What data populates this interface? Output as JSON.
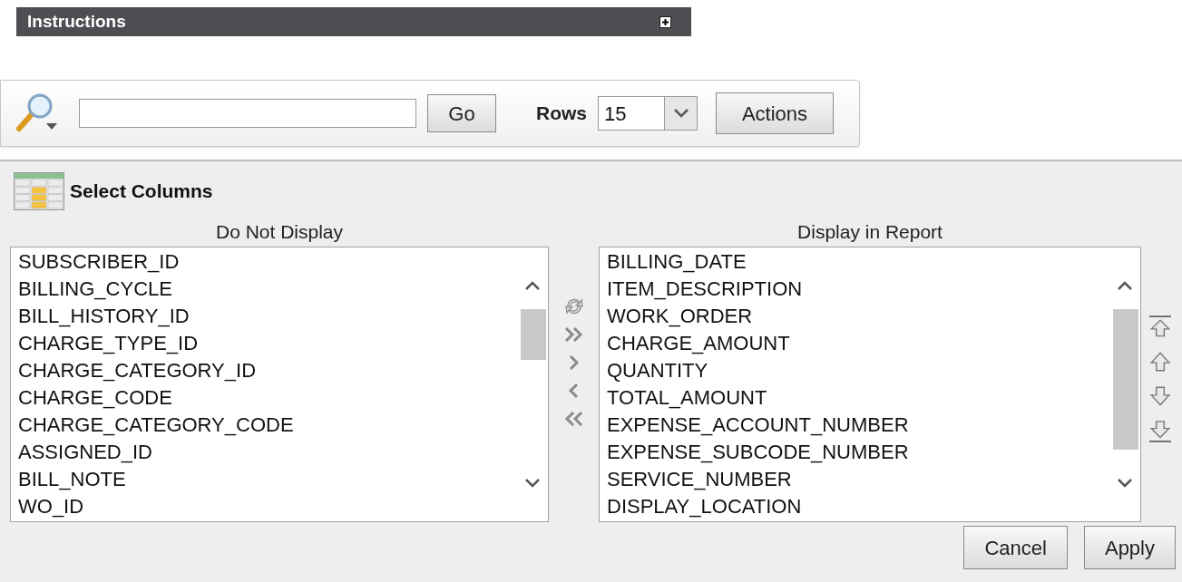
{
  "instructions": {
    "title": "Instructions",
    "expanded": false
  },
  "search_bar": {
    "go_button": "Go",
    "rows_label": "Rows",
    "rows_value": "15",
    "actions_button": "Actions"
  },
  "select_columns": {
    "title": "Select Columns",
    "do_not_display": {
      "header": "Do Not Display",
      "items": [
        "SUBSCRIBER_ID",
        "BILLING_CYCLE",
        "BILL_HISTORY_ID",
        "CHARGE_TYPE_ID",
        "CHARGE_CATEGORY_ID",
        "CHARGE_CODE",
        "CHARGE_CATEGORY_CODE",
        "ASSIGNED_ID",
        "BILL_NOTE",
        "WO_ID"
      ]
    },
    "display_in_report": {
      "header": "Display in Report",
      "items": [
        "BILLING_DATE",
        "ITEM_DESCRIPTION",
        "WORK_ORDER",
        "CHARGE_AMOUNT",
        "QUANTITY",
        "TOTAL_AMOUNT",
        "EXPENSE_ACCOUNT_NUMBER",
        "EXPENSE_SUBCODE_NUMBER",
        "SERVICE_NUMBER",
        "DISPLAY_LOCATION"
      ]
    },
    "buttons": [
      "Cancel",
      "Apply"
    ]
  }
}
